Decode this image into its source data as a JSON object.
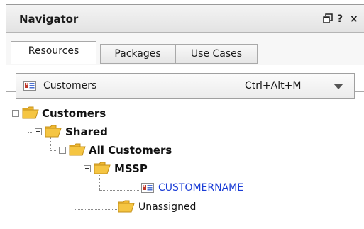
{
  "panel": {
    "title": "Navigator",
    "controls": {
      "restore": "restore-window-icon",
      "help": "?",
      "close": "×"
    }
  },
  "tabs": [
    {
      "label": "Resources",
      "active": true
    },
    {
      "label": "Packages",
      "active": false
    },
    {
      "label": "Use Cases",
      "active": false
    }
  ],
  "selector": {
    "icon": "entity-card-icon",
    "label": "Customers",
    "shortcut": "Ctrl+Alt+M",
    "dropdown_icon": "chevron-down-icon"
  },
  "tree": {
    "root": {
      "label": "Customers",
      "icon": "folder-icon",
      "expanded": true
    },
    "shared": {
      "label": "Shared",
      "icon": "folder-icon",
      "expanded": true
    },
    "all_customers": {
      "label": "All Customers",
      "icon": "folder-icon",
      "expanded": true
    },
    "mssp": {
      "label": "MSSP",
      "icon": "folder-icon",
      "expanded": true
    },
    "customername": {
      "label": "CUSTOMERNAME",
      "icon": "entity-card-icon",
      "link_color": "#1a3cd6"
    },
    "unassigned": {
      "label": "Unassigned",
      "icon": "folder-icon"
    }
  },
  "colors": {
    "folder_fill": "#f5c542",
    "folder_stroke": "#c4901a",
    "entity_red": "#c0392b",
    "link": "#1a3cd6"
  }
}
